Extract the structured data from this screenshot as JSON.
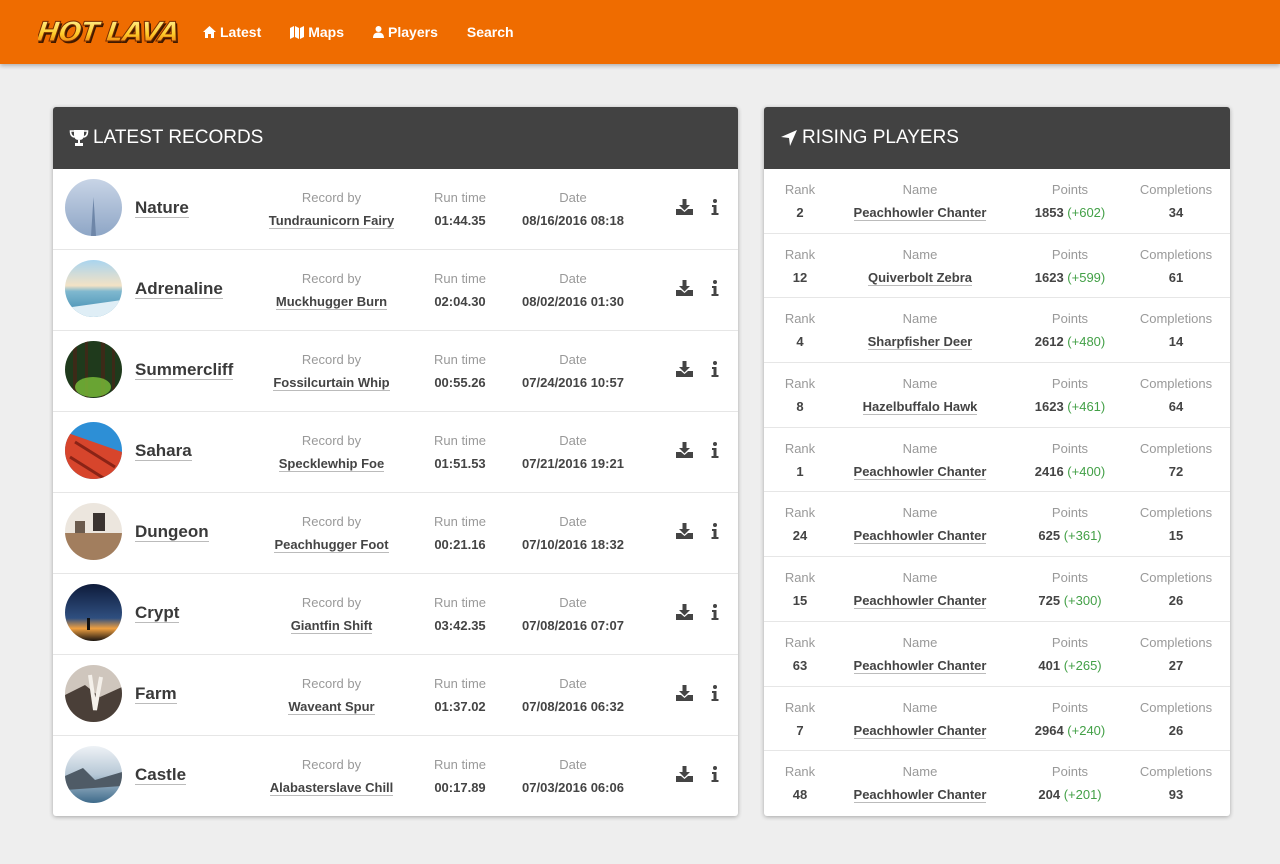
{
  "nav": {
    "logo_text": "HOT LAVA",
    "items": [
      {
        "label": "Latest",
        "icon": "home-icon"
      },
      {
        "label": "Maps",
        "icon": "map-icon"
      },
      {
        "label": "Players",
        "icon": "user-icon"
      },
      {
        "label": "Search",
        "icon": ""
      }
    ]
  },
  "colors": {
    "accent": "#ef6c00",
    "panel_header": "#424242",
    "gain": "#43a047"
  },
  "latest_records": {
    "title": "LATEST RECORDS",
    "labels": {
      "record_by": "Record by",
      "run_time": "Run time",
      "date": "Date"
    },
    "rows": [
      {
        "map": "Nature",
        "player": "Tundraunicorn Fairy",
        "time": "01:44.35",
        "date": "08/16/2016 08:18"
      },
      {
        "map": "Adrenaline",
        "player": "Muckhugger Burn",
        "time": "02:04.30",
        "date": "08/02/2016 01:30"
      },
      {
        "map": "Summercliff",
        "player": "Fossilcurtain Whip",
        "time": "00:55.26",
        "date": "07/24/2016 10:57"
      },
      {
        "map": "Sahara",
        "player": "Specklewhip Foe",
        "time": "01:51.53",
        "date": "07/21/2016 19:21"
      },
      {
        "map": "Dungeon",
        "player": "Peachhugger Foot",
        "time": "00:21.16",
        "date": "07/10/2016 18:32"
      },
      {
        "map": "Crypt",
        "player": "Giantfin Shift",
        "time": "03:42.35",
        "date": "07/08/2016 07:07"
      },
      {
        "map": "Farm",
        "player": "Waveant Spur",
        "time": "01:37.02",
        "date": "07/08/2016 06:32"
      },
      {
        "map": "Castle",
        "player": "Alabasterslave Chill",
        "time": "00:17.89",
        "date": "07/03/2016 06:06"
      }
    ]
  },
  "rising_players": {
    "title": "RISING PLAYERS",
    "labels": {
      "rank": "Rank",
      "name": "Name",
      "points": "Points",
      "completions": "Completions"
    },
    "rows": [
      {
        "rank": "2",
        "name": "Peachhowler Chanter",
        "points": "1853",
        "gain": "(+602)",
        "completions": "34"
      },
      {
        "rank": "12",
        "name": "Quiverbolt Zebra",
        "points": "1623",
        "gain": "(+599)",
        "completions": "61"
      },
      {
        "rank": "4",
        "name": "Sharpfisher Deer",
        "points": "2612",
        "gain": "(+480)",
        "completions": "14"
      },
      {
        "rank": "8",
        "name": "Hazelbuffalo Hawk",
        "points": "1623",
        "gain": "(+461)",
        "completions": "64"
      },
      {
        "rank": "1",
        "name": "Peachhowler Chanter",
        "points": "2416",
        "gain": "(+400)",
        "completions": "72"
      },
      {
        "rank": "24",
        "name": "Peachhowler Chanter",
        "points": "625",
        "gain": "(+361)",
        "completions": "15"
      },
      {
        "rank": "15",
        "name": "Peachhowler Chanter",
        "points": "725",
        "gain": "(+300)",
        "completions": "26"
      },
      {
        "rank": "63",
        "name": "Peachhowler Chanter",
        "points": "401",
        "gain": "(+265)",
        "completions": "27"
      },
      {
        "rank": "7",
        "name": "Peachhowler Chanter",
        "points": "2964",
        "gain": "(+240)",
        "completions": "26"
      },
      {
        "rank": "48",
        "name": "Peachhowler Chanter",
        "points": "204",
        "gain": "(+201)",
        "completions": "93"
      }
    ]
  }
}
